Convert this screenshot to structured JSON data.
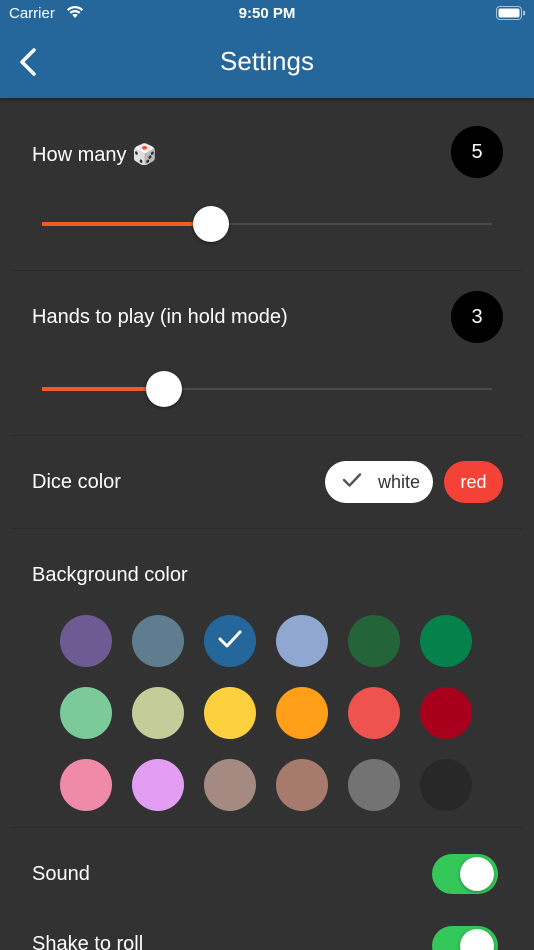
{
  "status_bar": {
    "carrier": "Carrier",
    "time": "9:50 PM"
  },
  "header": {
    "title": "Settings",
    "back_icon": "chevron-left-icon",
    "color": "#25679b"
  },
  "dice_count": {
    "label": "How many 🎲",
    "value": "5",
    "slider_fraction": 0.375
  },
  "hands": {
    "label": "Hands to play (in hold mode)",
    "value": "3",
    "slider_fraction": 0.27
  },
  "dice_color": {
    "label": "Dice color",
    "options": [
      {
        "label": "white",
        "selected": true
      },
      {
        "label": "red",
        "selected": false
      }
    ]
  },
  "background_color": {
    "label": "Background color",
    "selected": "#25679b",
    "swatches": [
      "#6f5b94",
      "#5f7d8f",
      "#25679b",
      "#8fa7d1",
      "#236539",
      "#05824b",
      "#7cc99a",
      "#c4cc99",
      "#fdd03f",
      "#ff9f1a",
      "#ef5350",
      "#a8001c",
      "#ef8aa8",
      "#e29ef3",
      "#a48a80",
      "#a67b6d",
      "#737373",
      "#282828"
    ]
  },
  "toggles": [
    {
      "label": "Sound",
      "on": true
    },
    {
      "label": "Shake to roll",
      "on": true
    }
  ],
  "accent_color": "#f05a28"
}
